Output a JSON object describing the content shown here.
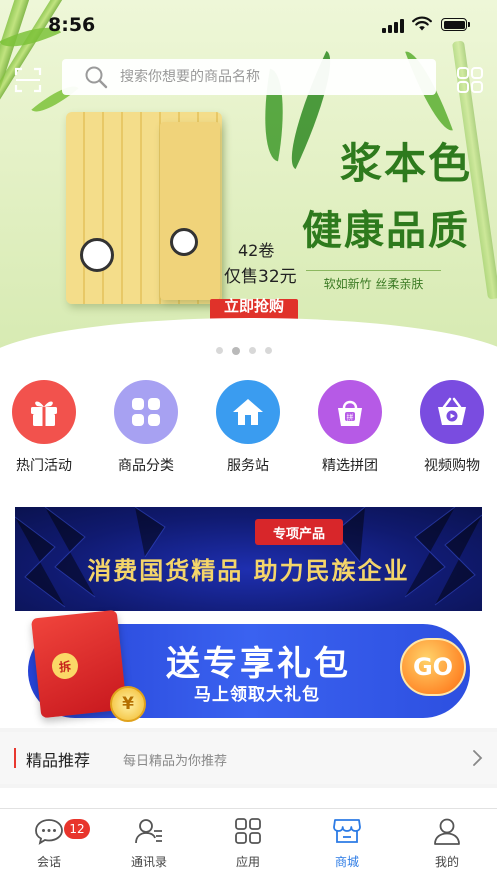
{
  "status_bar": {
    "time": "8:56"
  },
  "search": {
    "placeholder": "搜索你想要的商品名称"
  },
  "banner": {
    "headline_1": "浆本色",
    "headline_2": "健康品质",
    "tagline": "软如新竹  丝柔亲肤",
    "count": "42卷",
    "price": "仅售32元",
    "cta": "立即抢购 >>",
    "slide_count": 4,
    "active_slide": 2
  },
  "categories": [
    {
      "label": "热门活动",
      "color": "#f2524d",
      "icon": "gift-icon"
    },
    {
      "label": "商品分类",
      "color": "#a7a1f2",
      "icon": "grid-icon"
    },
    {
      "label": "服务站",
      "color": "#3a9cf0",
      "icon": "home-icon"
    },
    {
      "label": "精选拼团",
      "color": "#b65ae6",
      "icon": "shopping-bag-icon"
    },
    {
      "label": "视频购物",
      "color": "#7a4ce0",
      "icon": "video-basket-icon"
    }
  ],
  "promo_national": {
    "tag": "专项产品",
    "text": "消费国货精品  助力民族企业"
  },
  "promo_gift": {
    "title": "送专享礼包",
    "subtitle": "马上领取大礼包",
    "button": "GO",
    "envelope_label": "拆",
    "coin_label": "¥"
  },
  "recommend": {
    "title": "精品推荐",
    "subtitle": "每日精品为你推荐"
  },
  "tabbar": {
    "items": [
      {
        "label": "会话",
        "icon": "chat-icon",
        "badge": "12"
      },
      {
        "label": "通讯录",
        "icon": "contacts-icon"
      },
      {
        "label": "应用",
        "icon": "apps-icon"
      },
      {
        "label": "商城",
        "icon": "store-icon",
        "active": true
      },
      {
        "label": "我的",
        "icon": "profile-icon"
      }
    ],
    "active_color": "#2c7be5"
  }
}
